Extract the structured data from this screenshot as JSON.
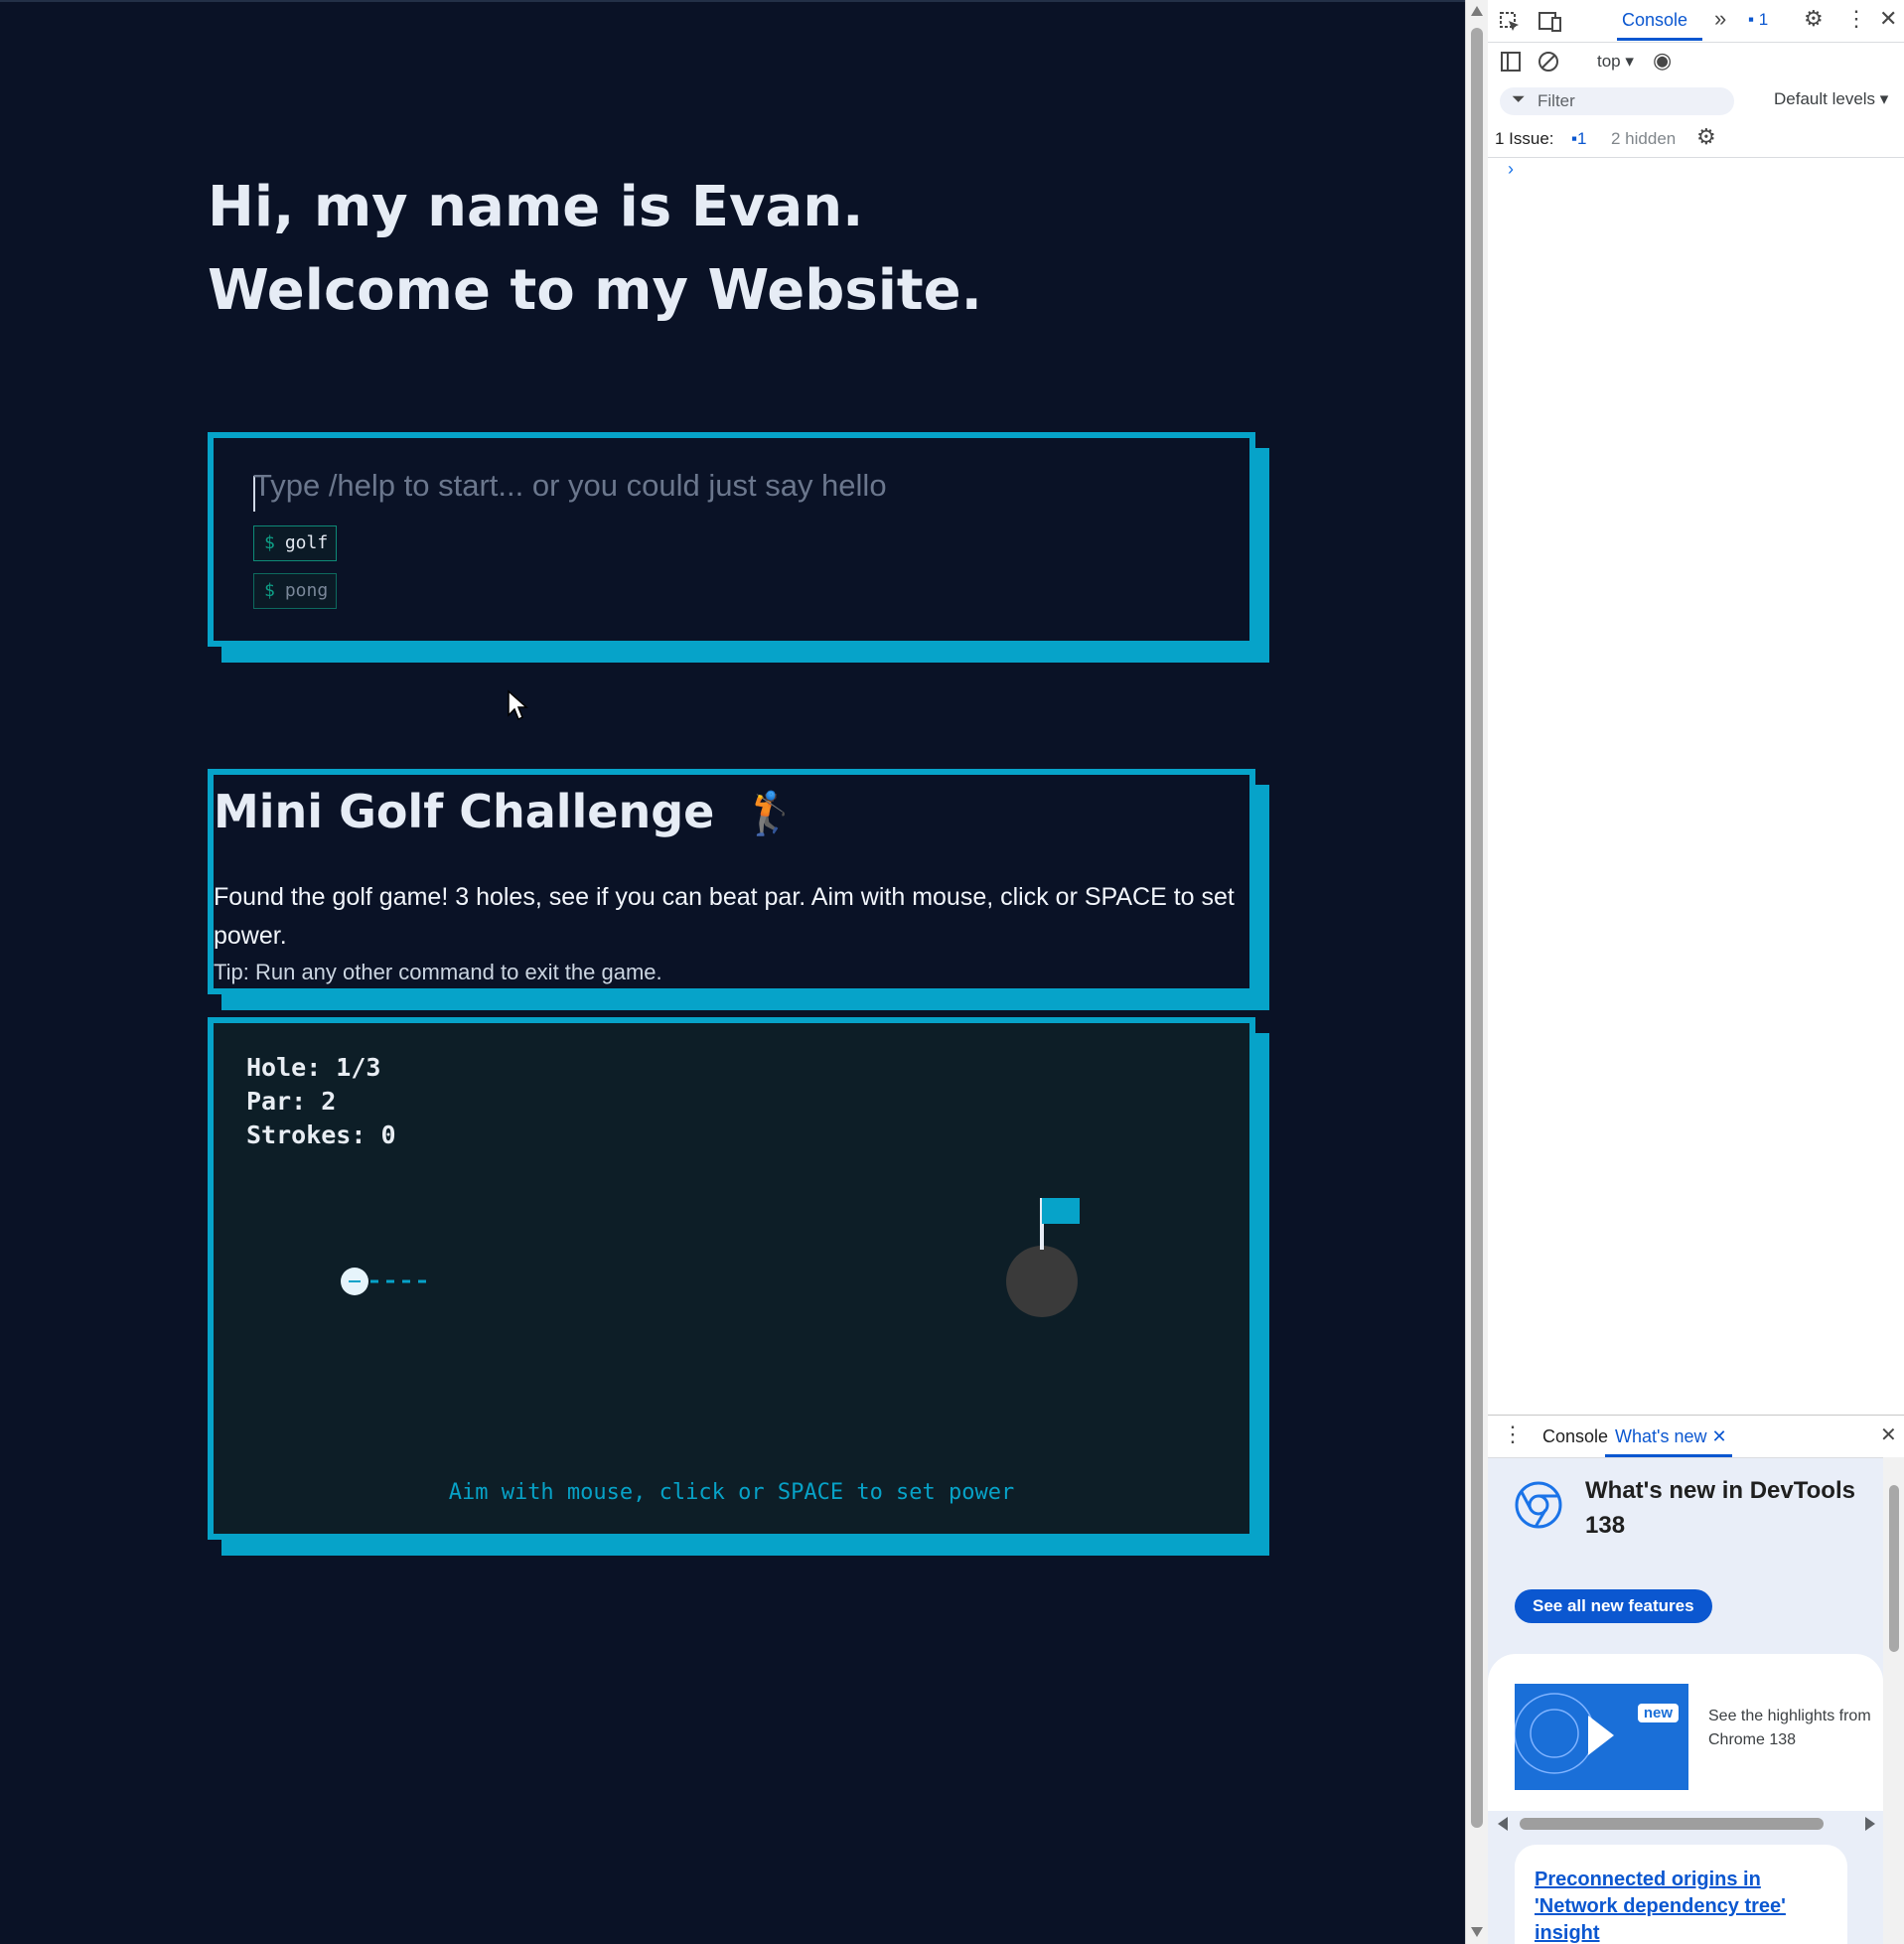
{
  "site": {
    "hero_line1": "Hi, my name is Evan.",
    "hero_line2": "Welcome to my Website.",
    "terminal": {
      "placeholder": "Type /help to start... or you could just say hello",
      "commands": [
        {
          "prompt": "$",
          "label": "golf"
        },
        {
          "prompt": "$",
          "label": "pong"
        }
      ]
    },
    "golf_info": {
      "title": "Mini Golf Challenge",
      "emoji": "🏌️",
      "description": "Found the golf game! 3 holes, see if you can beat par. Aim with mouse, click or SPACE to set power.",
      "tip": "Tip: Run any other command to exit the game."
    },
    "game": {
      "hole": "Hole: 1/3",
      "par": "Par: 2",
      "strokes": "Strokes: 0",
      "hint": "Aim with mouse, click or SPACE to set power"
    },
    "colors": {
      "background": "#0a1226",
      "accent": "#06a3c9",
      "game_bg": "#0d1e27",
      "command_border": "#0e8a77"
    }
  },
  "devtools": {
    "tab_console": "Console",
    "issues_count_badge": "1",
    "context": "top",
    "filter_placeholder": "Filter",
    "levels": "Default levels",
    "issues_label": "1 Issue:",
    "issues_badge": "1",
    "hidden": "2 hidden",
    "drawer": {
      "tab_console": "Console",
      "tab_whats_new": "What's new",
      "heading_line1": "What's new in DevTools",
      "heading_line2": "138",
      "see_all": "See all new features",
      "new_tag": "new",
      "highlight_line1": "See the highlights from",
      "highlight_line2": "Chrome 138",
      "link_line1": "Preconnected origins in",
      "link_line2": "'Network dependency tree'",
      "link_line3": "insight"
    },
    "icons": [
      "inspect-icon",
      "device-toolbar-icon",
      "more-tabs-icon",
      "issues-icon",
      "settings-icon",
      "kebab-icon",
      "close-icon",
      "sidebar-icon",
      "clear-icon",
      "eye-icon",
      "filter-icon",
      "gear-icon",
      "chrome-icon"
    ]
  }
}
